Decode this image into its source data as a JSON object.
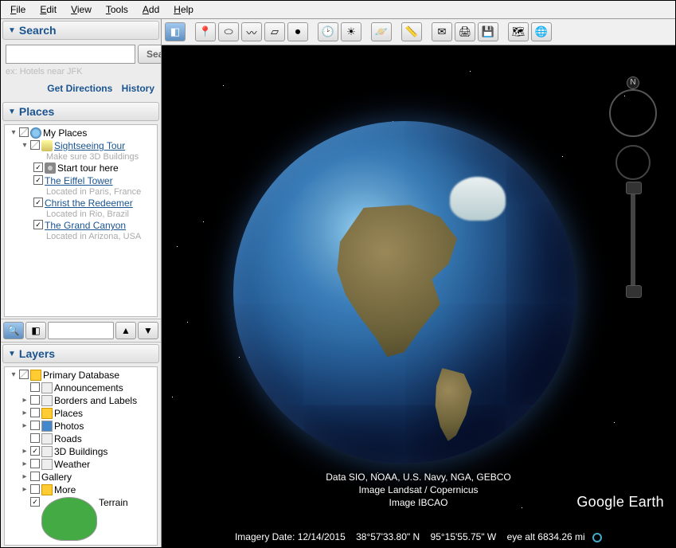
{
  "menubar": [
    "File",
    "Edit",
    "View",
    "Tools",
    "Add",
    "Help"
  ],
  "search": {
    "title": "Search",
    "button": "Search",
    "hint": "ex: Hotels near JFK",
    "directions": "Get Directions",
    "history": "History"
  },
  "places": {
    "title": "Places",
    "root": "My Places",
    "tour": "Sightseeing Tour",
    "tour_desc": "Make sure 3D Buildings",
    "start": "Start tour here",
    "eiffel": "The Eiffel Tower",
    "eiffel_desc": "Located in Paris, France",
    "christ": "Christ the Redeemer",
    "christ_desc": "Located in Rio, Brazil",
    "canyon": "The Grand Canyon",
    "canyon_desc": "Located in Arizona, USA"
  },
  "layers": {
    "title": "Layers",
    "root": "Primary Database",
    "items": [
      "Announcements",
      "Borders and Labels",
      "Places",
      "Photos",
      "Roads",
      "3D Buildings",
      "Weather",
      "Gallery",
      "More",
      "Terrain"
    ]
  },
  "attribution": {
    "line1": "Data SIO, NOAA, U.S. Navy, NGA, GEBCO",
    "line2": "Image Landsat / Copernicus",
    "line3": "Image IBCAO"
  },
  "brand": "Google Earth",
  "status": {
    "date_label": "Imagery Date:",
    "date": "12/14/2015",
    "lat": "38°57'33.80\" N",
    "lon": "95°15'55.75\" W",
    "alt_label": "eye alt",
    "alt": "6834.26 mi"
  },
  "compass": "N"
}
